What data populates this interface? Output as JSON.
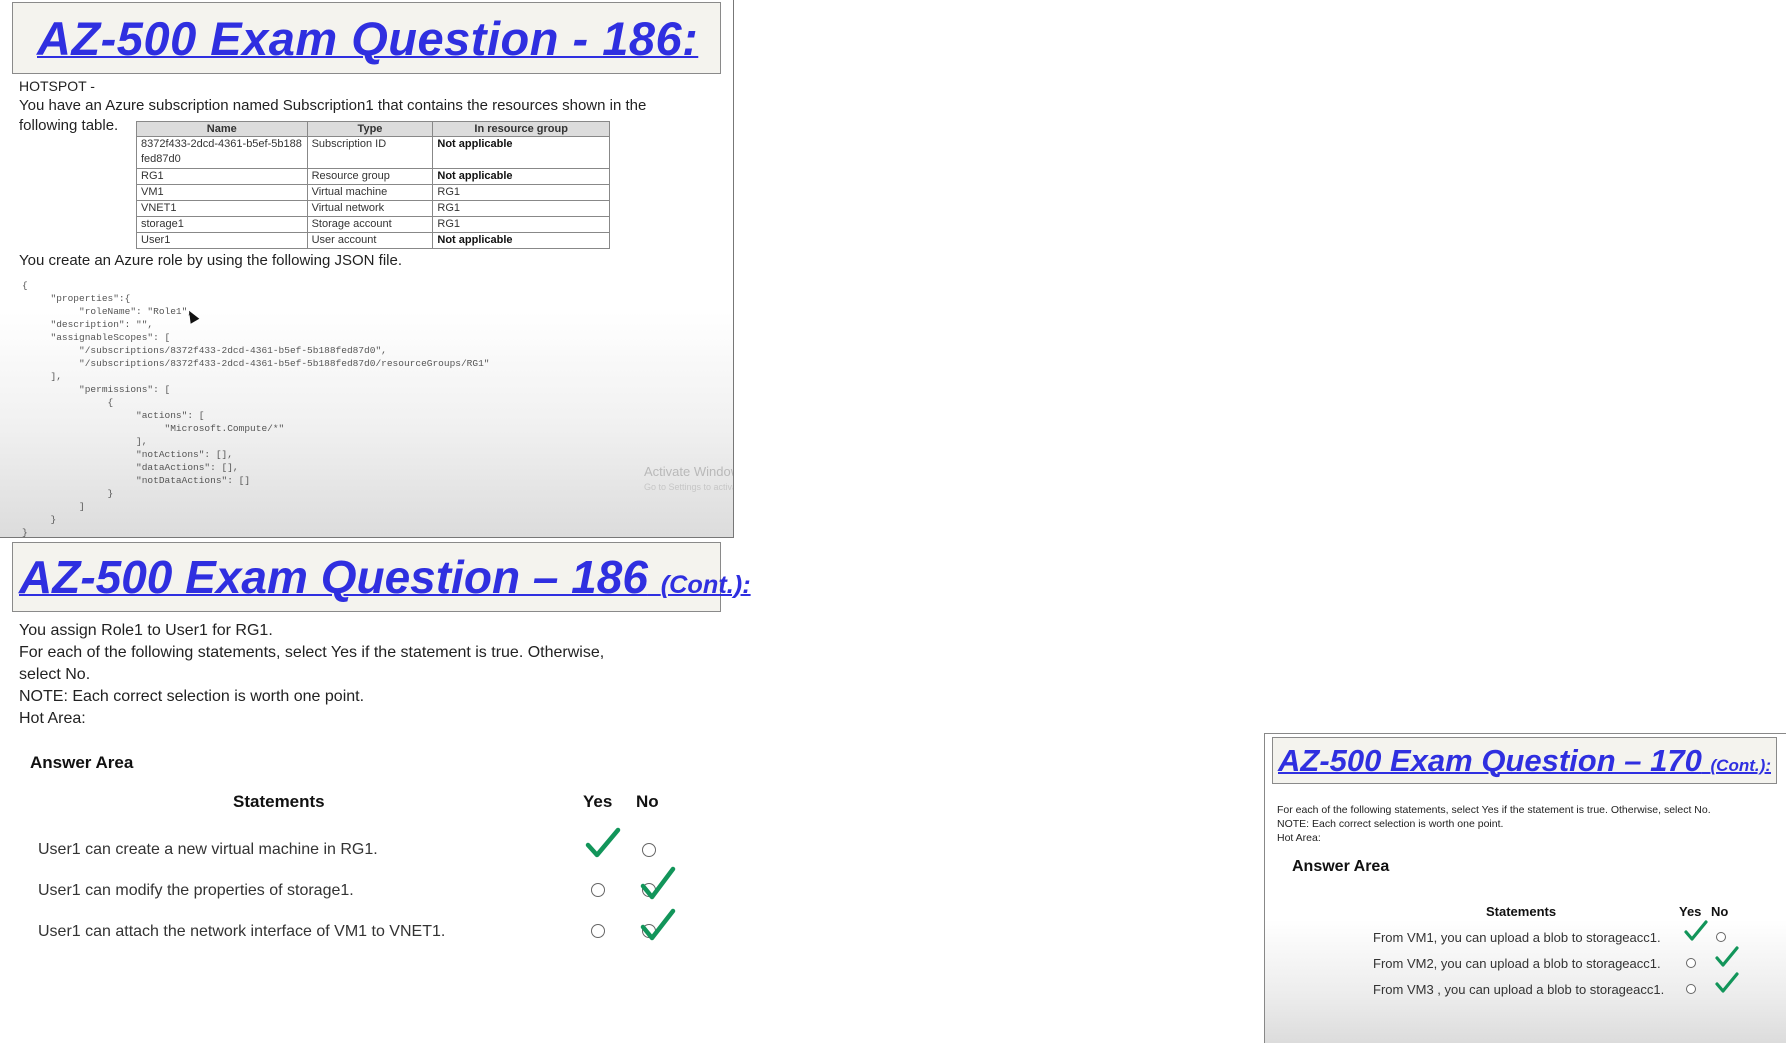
{
  "q186": {
    "title": "AZ-500 Exam Question - 186:",
    "hotspot": "HOTSPOT -",
    "intro_line1": "You have an Azure subscription named Subscription1 that contains the resources shown in the",
    "intro_line2": "following table.",
    "table": {
      "headers": [
        "Name",
        "Type",
        "In resource group"
      ],
      "rows": [
        [
          "8372f433-2dcd-4361-b5ef-5b188fed87d0",
          "Subscription ID",
          "Not applicable"
        ],
        [
          "RG1",
          "Resource group",
          "Not applicable"
        ],
        [
          "VM1",
          "Virtual machine",
          "RG1"
        ],
        [
          "VNET1",
          "Virtual network",
          "RG1"
        ],
        [
          "storage1",
          "Storage account",
          "RG1"
        ],
        [
          "User1",
          "User account",
          "Not applicable"
        ]
      ]
    },
    "json_intro": "You create an Azure role by using the following JSON file.",
    "json_code": "{\n     \"properties\":{\n          \"roleName\": \"Role1\",\n     \"description\": \"\",\n     \"assignableScopes\": [\n          \"/subscriptions/8372f433-2dcd-4361-b5ef-5b188fed87d0\",\n          \"/subscriptions/8372f433-2dcd-4361-b5ef-5b188fed87d0/resourceGroups/RG1\"\n     ],\n          \"permissions\": [\n               {\n                    \"actions\": [\n                         \"Microsoft.Compute/*\"\n                    ],\n                    \"notActions\": [],\n                    \"dataActions\": [],\n                    \"notDataActions\": []\n               }\n          ]\n     }\n}",
    "watermark": "Activate Windows",
    "watermark_sub": "Go to Settings to activate Windows."
  },
  "q186_cont": {
    "title_main": "AZ-500 Exam Question – 186",
    "title_suffix": "(Cont.):",
    "line1": "You assign Role1 to User1 for RG1.",
    "line2": "For each of the following statements, select Yes if the statement is true. Otherwise,",
    "line3": "select No.",
    "line4": "NOTE: Each correct selection is worth one point.",
    "line5": "Hot Area:",
    "answer_area": "Answer Area",
    "col_statements": "Statements",
    "col_yes": "Yes",
    "col_no": "No",
    "statements": [
      {
        "text": "User1 can create a new virtual machine in RG1.",
        "answer": "Yes"
      },
      {
        "text": "User1 can modify the properties of storage1.",
        "answer": "No"
      },
      {
        "text": "User1 can attach the network interface of VM1 to VNET1.",
        "answer": "No"
      }
    ]
  },
  "q170_cont": {
    "title_main": "AZ-500 Exam Question – 170",
    "title_suffix": "(Cont.):",
    "line1": "For each of the following statements, select Yes if the statement is true. Otherwise, select No.",
    "line2": "NOTE: Each correct selection is worth one point.",
    "line3": "Hot Area:",
    "answer_area": "Answer Area",
    "col_statements": "Statements",
    "col_yes": "Yes",
    "col_no": "No",
    "statements": [
      {
        "text": "From VM1, you can upload a blob to storageacc1.",
        "answer": "Yes"
      },
      {
        "text": "From VM2, you can upload a blob to storageacc1.",
        "answer": "No"
      },
      {
        "text": "From VM3 , you can upload a blob to storageacc1.",
        "answer": "No"
      }
    ]
  },
  "colors": {
    "title_blue": "#2f2fe0",
    "check_green": "#12955a"
  }
}
